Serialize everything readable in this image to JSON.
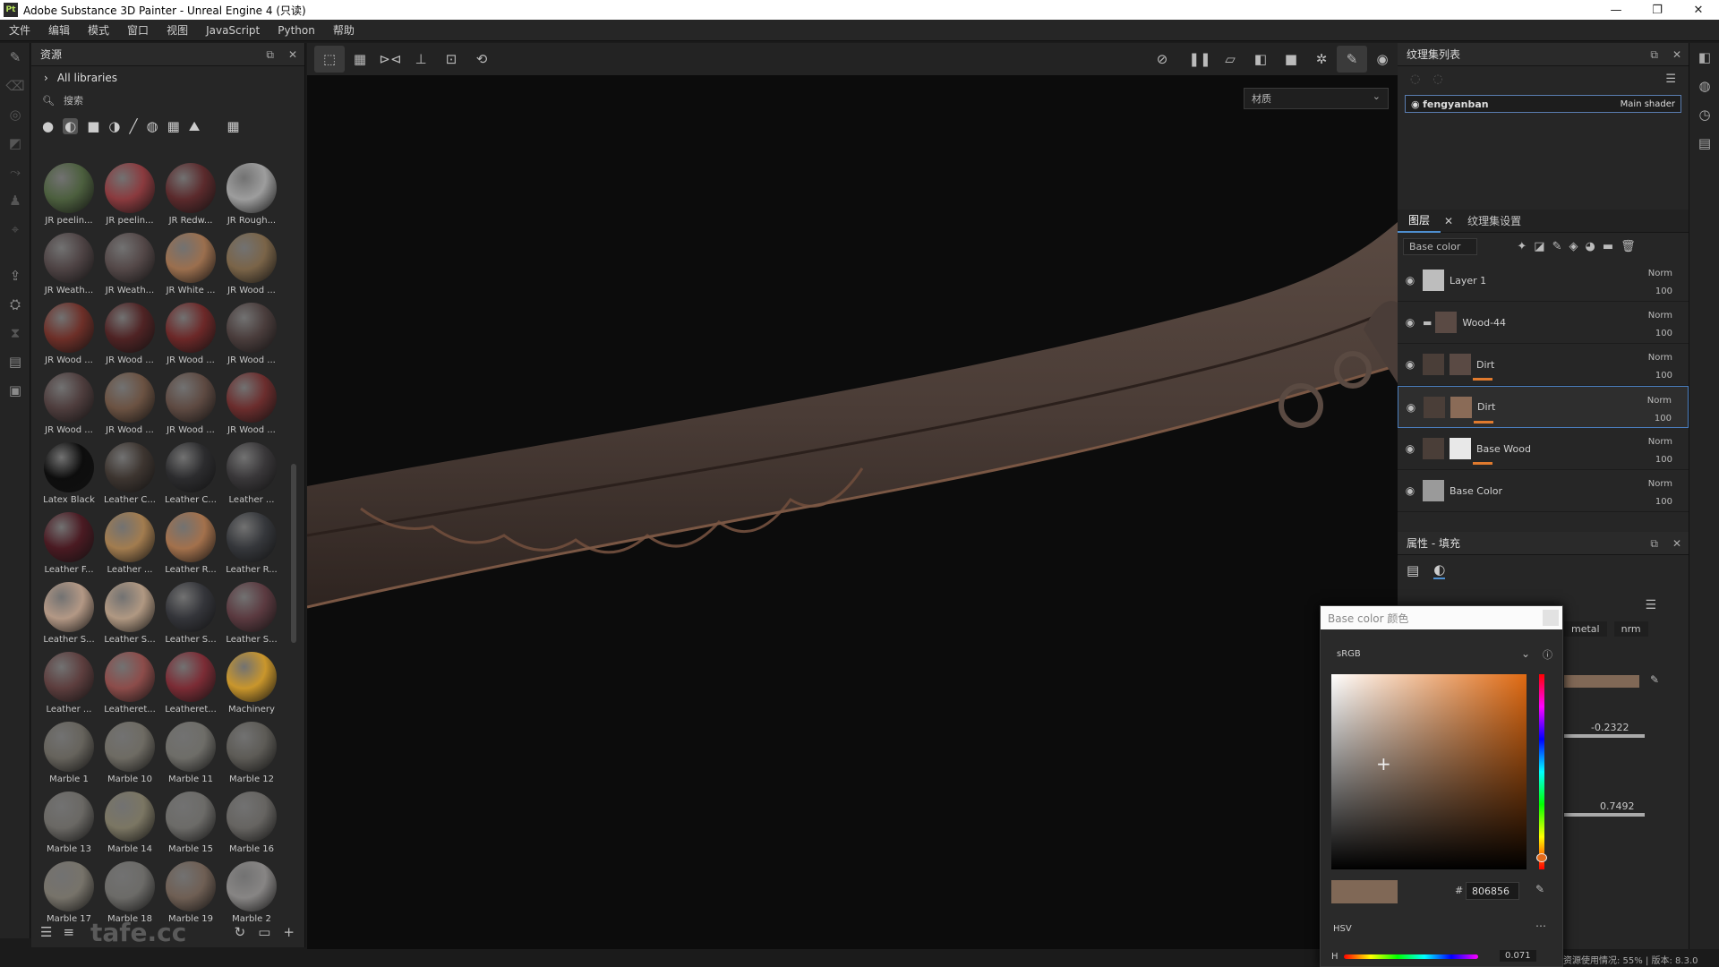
{
  "window": {
    "title": "Adobe Substance 3D Painter - Unreal Engine 4 (只读)",
    "logo": "Pt"
  },
  "menu": [
    "文件",
    "编辑",
    "模式",
    "窗口",
    "视图",
    "JavaScript",
    "Python",
    "帮助"
  ],
  "assets": {
    "panel_title": "资源",
    "libraries": "All libraries",
    "search_placeholder": "搜索",
    "items": [
      {
        "label": "JR peelin...",
        "color": "#4c5f3e"
      },
      {
        "label": "JR peelin...",
        "color": "#8a3a3e"
      },
      {
        "label": "JR Redw...",
        "color": "#5b2a2c"
      },
      {
        "label": "JR Rough...",
        "color": "#9d9d9d"
      },
      {
        "label": "JR Weath...",
        "color": "#4e4344"
      },
      {
        "label": "JR Weath...",
        "color": "#544848"
      },
      {
        "label": "JR White ...",
        "color": "#9b6f4e"
      },
      {
        "label": "JR Wood ...",
        "color": "#7a6448"
      },
      {
        "label": "JR Wood ...",
        "color": "#6d2f28"
      },
      {
        "label": "JR Wood ...",
        "color": "#4f2324"
      },
      {
        "label": "JR Wood ...",
        "color": "#6c2828"
      },
      {
        "label": "JR Wood ...",
        "color": "#4a3d3c"
      },
      {
        "label": "JR Wood ...",
        "color": "#4e3d3d"
      },
      {
        "label": "JR Wood ...",
        "color": "#6b5242"
      },
      {
        "label": "JR Wood ...",
        "color": "#5e4a42"
      },
      {
        "label": "JR Wood ...",
        "color": "#6b2d2d"
      },
      {
        "label": "Latex Black",
        "color": "#0d0d0d"
      },
      {
        "label": "Leather C...",
        "color": "#3d3530"
      },
      {
        "label": "Leather C...",
        "color": "#2c2c2e"
      },
      {
        "label": "Leather ...",
        "color": "#393739"
      },
      {
        "label": "Leather F...",
        "color": "#4a1a22"
      },
      {
        "label": "Leather ...",
        "color": "#a27c4f"
      },
      {
        "label": "Leather R...",
        "color": "#a3714c"
      },
      {
        "label": "Leather R...",
        "color": "#35373b"
      },
      {
        "label": "Leather S...",
        "color": "#b39885"
      },
      {
        "label": "Leather S...",
        "color": "#b09882"
      },
      {
        "label": "Leather S...",
        "color": "#34353a"
      },
      {
        "label": "Leather S...",
        "color": "#5b3a40"
      },
      {
        "label": "Leather ...",
        "color": "#5d3e3e"
      },
      {
        "label": "Leatheret...",
        "color": "#8c4c4a"
      },
      {
        "label": "Leatheret...",
        "color": "#7b2c35"
      },
      {
        "label": "Machinery",
        "color": "#c9962c"
      },
      {
        "label": "Marble 1",
        "color": "#66635c"
      },
      {
        "label": "Marble 10",
        "color": "#6e6b63"
      },
      {
        "label": "Marble 11",
        "color": "#6e6d68"
      },
      {
        "label": "Marble 12",
        "color": "#5d5b56"
      },
      {
        "label": "Marble 13",
        "color": "#6a6864"
      },
      {
        "label": "Marble 14",
        "color": "#7b7663"
      },
      {
        "label": "Marble 15",
        "color": "#6c6b68"
      },
      {
        "label": "Marble 16",
        "color": "#666461"
      },
      {
        "label": "Marble 17",
        "color": "#77736a"
      },
      {
        "label": "Marble 18",
        "color": "#6c6b68"
      },
      {
        "label": "Marble 19",
        "color": "#6f5f54"
      },
      {
        "label": "Marble 2",
        "color": "#878584"
      }
    ]
  },
  "viewport": {
    "material_mode": "材质"
  },
  "texture_sets": {
    "panel_title": "纹理集列表",
    "item_name": "fengyanban",
    "shader": "Main shader"
  },
  "layers": {
    "tab_layers": "图层",
    "tab_settings": "纹理集设置",
    "channel": "Base color",
    "rows": [
      {
        "name": "Layer 1",
        "blend": "Norm",
        "opacity": "100"
      },
      {
        "name": "Wood-44",
        "blend": "Norm",
        "opacity": "100"
      },
      {
        "name": "Dirt",
        "blend": "Norm",
        "opacity": "100"
      },
      {
        "name": "Dirt",
        "blend": "Norm",
        "opacity": "100"
      },
      {
        "name": "Base Wood",
        "blend": "Norm",
        "opacity": "100"
      },
      {
        "name": "Base Color",
        "blend": "Norm",
        "opacity": "100"
      }
    ]
  },
  "properties": {
    "panel_title": "属性 - 填充",
    "chip_metal": "metal",
    "chip_nrm": "nrm",
    "value1": "-0.2322",
    "value2": "0.7492"
  },
  "color_picker": {
    "title": "Base color 颜色",
    "space": "sRGB",
    "hex_label": "#",
    "hex": "806856",
    "swatch": "#806856",
    "mode": "HSV",
    "h_label": "H",
    "h_value": "0.071"
  },
  "status": {
    "text": "资源使用情况:  55%  |  版本:  8.3.0"
  },
  "watermark": "tafe.cc"
}
